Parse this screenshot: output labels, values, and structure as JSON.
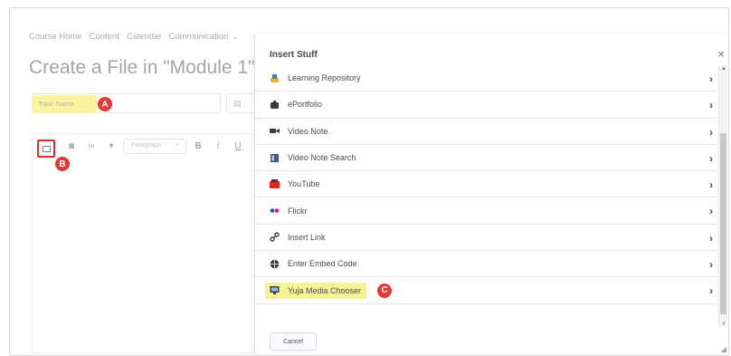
{
  "background": {
    "nav": [
      "Course Home",
      "Content",
      "Calendar",
      "Communication"
    ],
    "title": "Create a File in \"Module 1\"",
    "topic_placeholder": "Topic Name",
    "toolbar_format": "Paragraph",
    "toolbar_bold": "B",
    "toolbar_italic": "I",
    "toolbar_underline": "U"
  },
  "markers": {
    "a": "A",
    "b": "B",
    "c": "C"
  },
  "modal": {
    "title": "Insert Stuff",
    "close": "×",
    "items": [
      {
        "label": "Learning Repository",
        "icon": "learning-repository-icon"
      },
      {
        "label": "ePortfolio",
        "icon": "eportfolio-icon"
      },
      {
        "label": "Video Note",
        "icon": "video-camera-icon"
      },
      {
        "label": "Video Note Search",
        "icon": "video-search-icon"
      },
      {
        "label": "YouTube",
        "icon": "youtube-icon"
      },
      {
        "label": "Flickr",
        "icon": "flickr-icon"
      },
      {
        "label": "Insert Link",
        "icon": "link-icon"
      },
      {
        "label": "Enter Embed Code",
        "icon": "globe-icon"
      },
      {
        "label": "Yuja Media Chooser",
        "icon": "yuja-icon",
        "highlighted": true
      }
    ],
    "cancel": "Cancel"
  },
  "colors": {
    "highlight": "#f6f394",
    "marker": "#e53935",
    "youtube": "#e62117",
    "flickr_blue": "#0063dc",
    "flickr_pink": "#ff0084"
  }
}
